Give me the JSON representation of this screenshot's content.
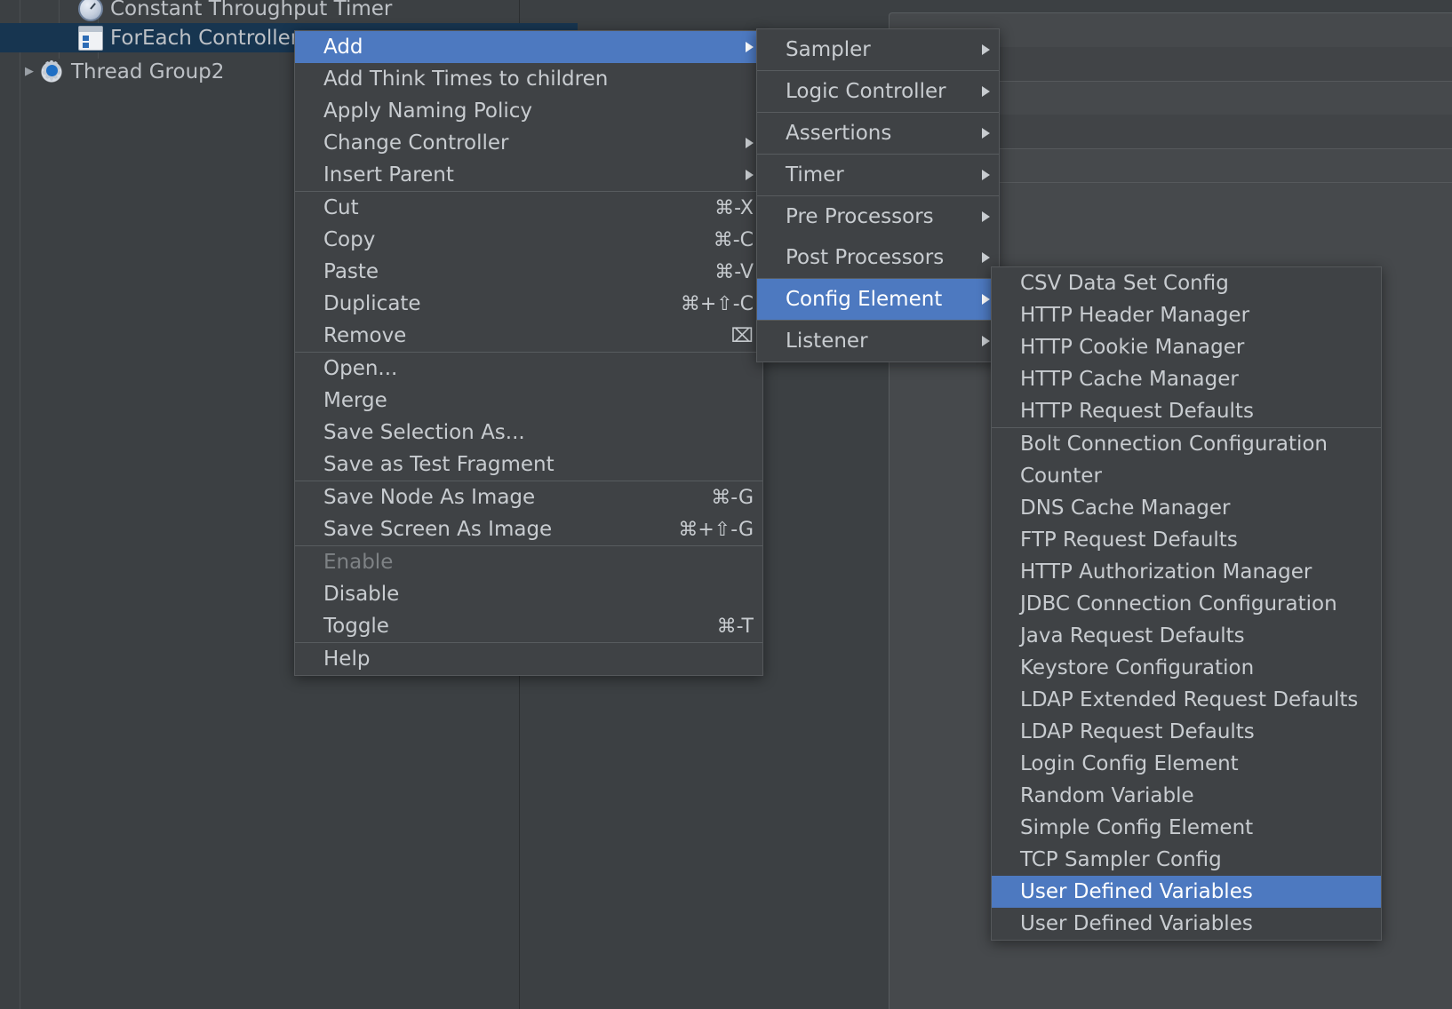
{
  "tree": {
    "items": [
      {
        "label": "Constant Throughput Timer",
        "icon": "clock-icon",
        "indent": 2,
        "selected": false,
        "expander": ""
      },
      {
        "label": "ForEach Controller",
        "icon": "foreach-icon",
        "indent": 2,
        "selected": true,
        "expander": ""
      },
      {
        "label": "Thread Group2",
        "icon": "gear-icon",
        "indent": 1,
        "selected": false,
        "expander": "▶"
      }
    ]
  },
  "context_menu": {
    "groups": [
      {
        "items": [
          {
            "label": "Add",
            "accel": "",
            "submenu": true,
            "highlight": true,
            "disabled": false
          },
          {
            "label": "Add Think Times to children",
            "accel": "",
            "submenu": false,
            "highlight": false,
            "disabled": false
          },
          {
            "label": "Apply Naming Policy",
            "accel": "",
            "submenu": false,
            "highlight": false,
            "disabled": false
          },
          {
            "label": "Change Controller",
            "accel": "",
            "submenu": true,
            "highlight": false,
            "disabled": false
          },
          {
            "label": "Insert Parent",
            "accel": "",
            "submenu": true,
            "highlight": false,
            "disabled": false
          }
        ]
      },
      {
        "items": [
          {
            "label": "Cut",
            "accel": "⌘-X",
            "submenu": false,
            "highlight": false,
            "disabled": false
          },
          {
            "label": "Copy",
            "accel": "⌘-C",
            "submenu": false,
            "highlight": false,
            "disabled": false
          },
          {
            "label": "Paste",
            "accel": "⌘-V",
            "submenu": false,
            "highlight": false,
            "disabled": false
          },
          {
            "label": "Duplicate",
            "accel": "⌘+⇧-C",
            "submenu": false,
            "highlight": false,
            "disabled": false
          },
          {
            "label": "Remove",
            "accel": "⌧",
            "submenu": false,
            "highlight": false,
            "disabled": false
          }
        ]
      },
      {
        "items": [
          {
            "label": "Open...",
            "accel": "",
            "submenu": false,
            "highlight": false,
            "disabled": false
          },
          {
            "label": "Merge",
            "accel": "",
            "submenu": false,
            "highlight": false,
            "disabled": false
          },
          {
            "label": "Save Selection As...",
            "accel": "",
            "submenu": false,
            "highlight": false,
            "disabled": false
          },
          {
            "label": "Save as Test Fragment",
            "accel": "",
            "submenu": false,
            "highlight": false,
            "disabled": false
          }
        ]
      },
      {
        "items": [
          {
            "label": "Save Node As Image",
            "accel": "⌘-G",
            "submenu": false,
            "highlight": false,
            "disabled": false
          },
          {
            "label": "Save Screen As Image",
            "accel": "⌘+⇧-G",
            "submenu": false,
            "highlight": false,
            "disabled": false
          }
        ]
      },
      {
        "items": [
          {
            "label": "Enable",
            "accel": "",
            "submenu": false,
            "highlight": false,
            "disabled": true
          },
          {
            "label": "Disable",
            "accel": "",
            "submenu": false,
            "highlight": false,
            "disabled": false
          },
          {
            "label": "Toggle",
            "accel": "⌘-T",
            "submenu": false,
            "highlight": false,
            "disabled": false
          }
        ]
      },
      {
        "items": [
          {
            "label": "Help",
            "accel": "",
            "submenu": false,
            "highlight": false,
            "disabled": false
          }
        ]
      }
    ]
  },
  "add_menu": {
    "groups": [
      {
        "items": [
          {
            "label": "Sampler",
            "submenu": true,
            "highlight": false
          }
        ]
      },
      {
        "items": [
          {
            "label": "Logic Controller",
            "submenu": true,
            "highlight": false
          }
        ]
      },
      {
        "items": [
          {
            "label": "Assertions",
            "submenu": true,
            "highlight": false
          }
        ]
      },
      {
        "items": [
          {
            "label": "Timer",
            "submenu": true,
            "highlight": false
          }
        ]
      },
      {
        "items": [
          {
            "label": "Pre Processors",
            "submenu": true,
            "highlight": false
          },
          {
            "label": "Post Processors",
            "submenu": true,
            "highlight": false
          }
        ]
      },
      {
        "items": [
          {
            "label": "Config Element",
            "submenu": true,
            "highlight": true
          }
        ]
      },
      {
        "items": [
          {
            "label": "Listener",
            "submenu": true,
            "highlight": false
          }
        ]
      }
    ]
  },
  "config_menu": {
    "groups": [
      {
        "items": [
          {
            "label": "CSV Data Set Config",
            "highlight": false
          },
          {
            "label": "HTTP Header Manager",
            "highlight": false
          },
          {
            "label": "HTTP Cookie Manager",
            "highlight": false
          },
          {
            "label": "HTTP Cache Manager",
            "highlight": false
          },
          {
            "label": "HTTP Request Defaults",
            "highlight": false
          }
        ]
      },
      {
        "items": [
          {
            "label": "Bolt Connection Configuration",
            "highlight": false
          },
          {
            "label": "Counter",
            "highlight": false
          },
          {
            "label": "DNS Cache Manager",
            "highlight": false
          },
          {
            "label": "FTP Request Defaults",
            "highlight": false
          },
          {
            "label": "HTTP Authorization Manager",
            "highlight": false
          },
          {
            "label": "JDBC Connection Configuration",
            "highlight": false
          },
          {
            "label": "Java Request Defaults",
            "highlight": false
          },
          {
            "label": "Keystore Configuration",
            "highlight": false
          },
          {
            "label": "LDAP Extended Request Defaults",
            "highlight": false
          },
          {
            "label": "LDAP Request Defaults",
            "highlight": false
          },
          {
            "label": "Login Config Element",
            "highlight": false
          },
          {
            "label": "Random Variable",
            "highlight": false
          },
          {
            "label": "Simple Config Element",
            "highlight": false
          },
          {
            "label": "TCP Sampler Config",
            "highlight": false
          },
          {
            "label": "User Defined Variables",
            "highlight": true
          },
          {
            "label": "User Defined Variables",
            "highlight": false
          }
        ]
      }
    ]
  },
  "colors": {
    "menu_background": "#3f4245",
    "menu_text": "#c8ccd0",
    "highlight": "#4d79c0",
    "highlight_text": "#ffffff",
    "disabled_text": "#7e8285",
    "tree_selected": "#173550",
    "app_background": "#3c4043"
  }
}
